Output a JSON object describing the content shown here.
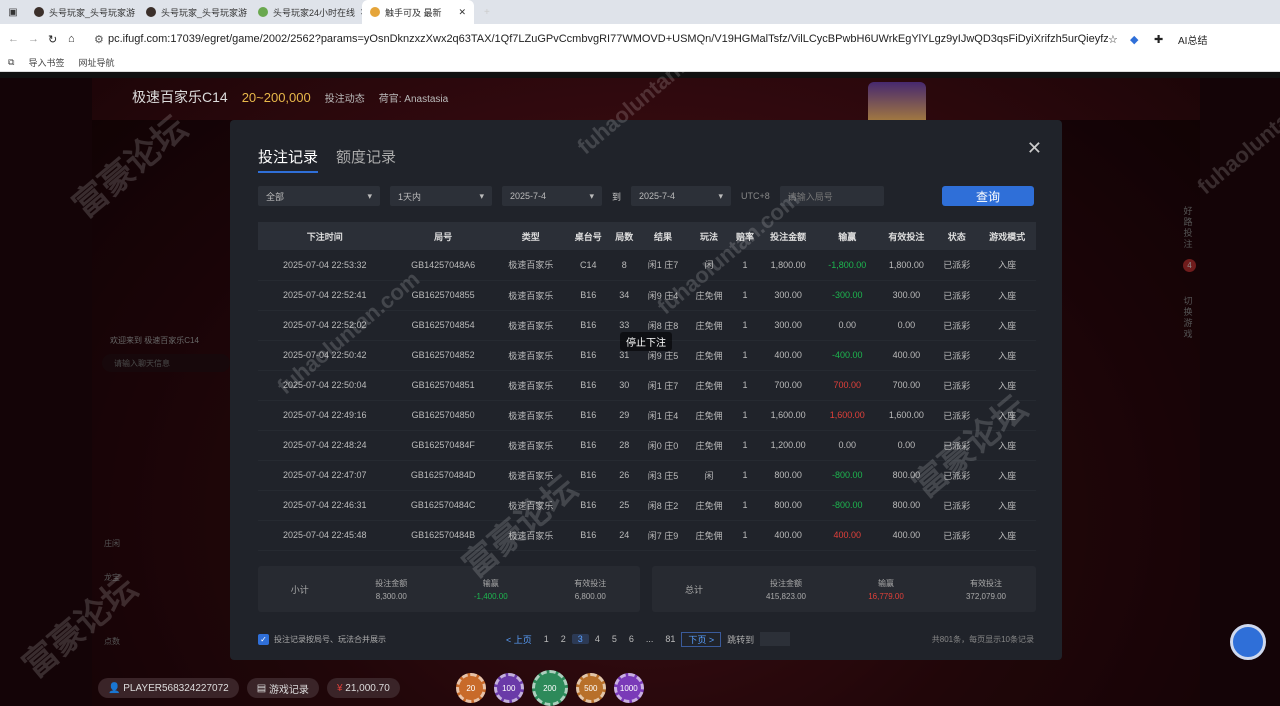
{
  "browser": {
    "tabs": [
      {
        "label": "头号玩家_头号玩家游",
        "color": "#3b2f2a"
      },
      {
        "label": "头号玩家_头号玩家游",
        "color": "#3b2f2a"
      },
      {
        "label": "头号玩家24小时在线",
        "color": "#6aa84f"
      },
      {
        "label": "触手可及 最新",
        "color": "#e5a53a"
      }
    ],
    "url": "pc.ifugf.com:17039/egret/game/2002/2562?params=yOsnDknzxzXwx2q63TAX/1Qf7LZuGPvCcmbvgRI77WMOVD+USMQn/V19HGMalTsfz/VilLCycBPwbH6UWrkEgYlYLgz9yIJwQD3qsFiDyiXrifzh5urQieyfz8DwLSKchxTr...",
    "ai_label": "AI总结",
    "bookmarks": [
      "导入书签",
      "网址导航"
    ]
  },
  "game": {
    "room_title": "极速百家乐C14",
    "range": "20~200,000",
    "notice": "投注动态",
    "dealer": "荷官: Anastasia",
    "chat_welcome": "欢迎来到 极速百家乐C14",
    "chat_placeholder": "请输入聊天信息",
    "side_menu_1": "好路投注",
    "side_menu_badge": "4",
    "side_menu_2": "切换游戏",
    "stop_bet": "停止下注",
    "player_id": "PLAYER568324227072",
    "game_record": "游戏记录",
    "balance": "21,000.70",
    "chips": [
      "20",
      "100",
      "200",
      "500",
      "1000"
    ],
    "road_labels": [
      "庄闲",
      "龙宝",
      "点数"
    ]
  },
  "modal": {
    "tab_bets": "投注记录",
    "tab_quota": "额度记录",
    "filter_type": "全部",
    "filter_period": "1天内",
    "date_from": "2025-7-4",
    "date_to_label": "到",
    "date_to": "2025-7-4",
    "utc_label": "UTC+8",
    "table_no_placeholder": "请输入局号",
    "query_btn": "查询",
    "headers": [
      "下注时间",
      "局号",
      "类型",
      "桌台号",
      "局数",
      "结果",
      "玩法",
      "赔率",
      "投注金额",
      "输赢",
      "有效投注",
      "状态",
      "游戏模式"
    ],
    "rows": [
      [
        "2025-07-04 22:53:32",
        "GB14257048A6",
        "极速百家乐",
        "C14",
        "8",
        "闲1 庄7",
        "闲",
        "1",
        "1,800.00",
        "-1,800.00",
        "1,800.00",
        "已派彩",
        "入座"
      ],
      [
        "2025-07-04 22:52:41",
        "GB1625704855",
        "极速百家乐",
        "B16",
        "34",
        "闲9 庄4",
        "庄免佣",
        "1",
        "300.00",
        "-300.00",
        "300.00",
        "已派彩",
        "入座"
      ],
      [
        "2025-07-04 22:52:02",
        "GB1625704854",
        "极速百家乐",
        "B16",
        "33",
        "闲8 庄8",
        "庄免佣",
        "1",
        "300.00",
        "0.00",
        "0.00",
        "已派彩",
        "入座"
      ],
      [
        "2025-07-04 22:50:42",
        "GB1625704852",
        "极速百家乐",
        "B16",
        "31",
        "闲9 庄5",
        "庄免佣",
        "1",
        "400.00",
        "-400.00",
        "400.00",
        "已派彩",
        "入座"
      ],
      [
        "2025-07-04 22:50:04",
        "GB1625704851",
        "极速百家乐",
        "B16",
        "30",
        "闲1 庄7",
        "庄免佣",
        "1",
        "700.00",
        "700.00",
        "700.00",
        "已派彩",
        "入座"
      ],
      [
        "2025-07-04 22:49:16",
        "GB1625704850",
        "极速百家乐",
        "B16",
        "29",
        "闲1 庄4",
        "庄免佣",
        "1",
        "1,600.00",
        "1,600.00",
        "1,600.00",
        "已派彩",
        "入座"
      ],
      [
        "2025-07-04 22:48:24",
        "GB162570484F",
        "极速百家乐",
        "B16",
        "28",
        "闲0 庄0",
        "庄免佣",
        "1",
        "1,200.00",
        "0.00",
        "0.00",
        "已派彩",
        "入座"
      ],
      [
        "2025-07-04 22:47:07",
        "GB162570484D",
        "极速百家乐",
        "B16",
        "26",
        "闲3 庄5",
        "闲",
        "1",
        "800.00",
        "-800.00",
        "800.00",
        "已派彩",
        "入座"
      ],
      [
        "2025-07-04 22:46:31",
        "GB162570484C",
        "极速百家乐",
        "B16",
        "25",
        "闲8 庄2",
        "庄免佣",
        "1",
        "800.00",
        "-800.00",
        "800.00",
        "已派彩",
        "入座"
      ],
      [
        "2025-07-04 22:45:48",
        "GB162570484B",
        "极速百家乐",
        "B16",
        "24",
        "闲7 庄9",
        "庄免佣",
        "1",
        "400.00",
        "400.00",
        "400.00",
        "已派彩",
        "入座"
      ]
    ],
    "subtotal_label": "小计",
    "total_label": "总计",
    "sum_headers": [
      "投注金额",
      "输赢",
      "有效投注"
    ],
    "subtotal": [
      "8,300.00",
      "-1,400.00",
      "6,800.00"
    ],
    "total": [
      "415,823.00",
      "16,779.00",
      "372,079.00"
    ],
    "merge_label": "投注记录按局号、玩法合并展示",
    "prev": "< 上页",
    "pages": [
      "1",
      "2",
      "3",
      "4",
      "5",
      "6",
      "...",
      "81"
    ],
    "current_page": "3",
    "next": "下页 >",
    "goto": "跳转到",
    "count_info": "共801条，每页显示10条记录"
  },
  "watermark": {
    "cn": "富豪论坛",
    "en": "fuhaoluntan.com"
  }
}
